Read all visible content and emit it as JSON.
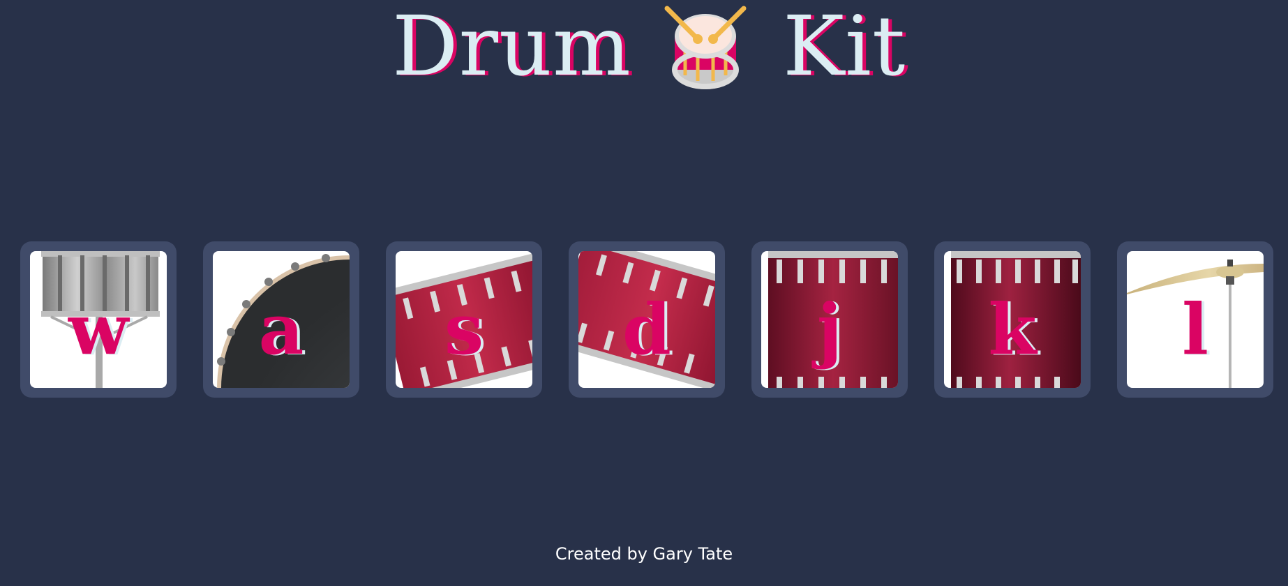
{
  "header": {
    "title_left": "Drum",
    "title_right": "Kit",
    "icon": "drum-emoji-icon"
  },
  "pads": [
    {
      "key": "w",
      "instrument_icon": "tom-drum-icon"
    },
    {
      "key": "a",
      "instrument_icon": "bass-drum-icon"
    },
    {
      "key": "s",
      "instrument_icon": "tom-drum-icon"
    },
    {
      "key": "d",
      "instrument_icon": "tom-drum-icon"
    },
    {
      "key": "j",
      "instrument_icon": "snare-drum-icon"
    },
    {
      "key": "k",
      "instrument_icon": "floor-tom-icon"
    },
    {
      "key": "l",
      "instrument_icon": "cymbal-icon"
    }
  ],
  "footer": {
    "credit": "Created by Gary Tate"
  },
  "colors": {
    "background": "#283149",
    "pad_frame": "#404b69",
    "accent": "#da0463",
    "text_light": "#dbedf3"
  }
}
